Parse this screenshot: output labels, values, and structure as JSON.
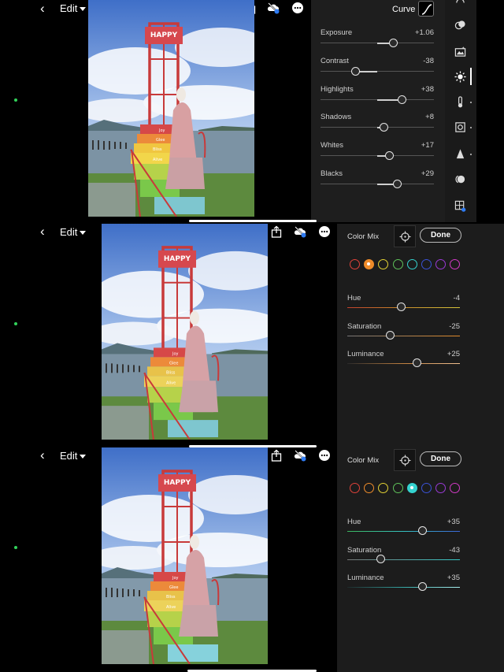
{
  "nav": {
    "edit_label": "Edit"
  },
  "panel1": {
    "title": "Curve",
    "sliders": [
      {
        "label": "Exposure",
        "value": "+1.06",
        "pos": 0.64
      },
      {
        "label": "Contrast",
        "value": "-38",
        "pos": 0.31
      },
      {
        "label": "Highlights",
        "value": "+38",
        "pos": 0.72
      },
      {
        "label": "Shadows",
        "value": "+8",
        "pos": 0.56
      },
      {
        "label": "Whites",
        "value": "+17",
        "pos": 0.61
      },
      {
        "label": "Blacks",
        "value": "+29",
        "pos": 0.68
      }
    ]
  },
  "panel2": {
    "title": "Color Mix",
    "done_label": "Done",
    "selected_swatch": "orange",
    "sliders": [
      {
        "label": "Hue",
        "value": "-4",
        "pos": 0.48
      },
      {
        "label": "Saturation",
        "value": "-25",
        "pos": 0.38
      },
      {
        "label": "Luminance",
        "value": "+25",
        "pos": 0.62
      }
    ]
  },
  "panel3": {
    "title": "Color Mix",
    "done_label": "Done",
    "selected_swatch": "aqua",
    "sliders": [
      {
        "label": "Hue",
        "value": "+35",
        "pos": 0.67
      },
      {
        "label": "Saturation",
        "value": "-43",
        "pos": 0.3
      },
      {
        "label": "Luminance",
        "value": "+35",
        "pos": 0.67
      }
    ]
  },
  "swatches": [
    {
      "name": "red",
      "color": "#e0423a"
    },
    {
      "name": "orange",
      "color": "#ef8c2a"
    },
    {
      "name": "yellow",
      "color": "#e3d234"
    },
    {
      "name": "green",
      "color": "#5fc25a"
    },
    {
      "name": "aqua",
      "color": "#35d3d0"
    },
    {
      "name": "blue",
      "color": "#3a52d6"
    },
    {
      "name": "purple",
      "color": "#9a3ad6"
    },
    {
      "name": "magenta",
      "color": "#d23ac6"
    }
  ],
  "gradients": {
    "orange_hue": "linear-gradient(90deg,#c2402c,#c88d2a,#d6c43a)",
    "orange_sat": "linear-gradient(90deg,#777,#e08a2a)",
    "orange_lum": "linear-gradient(90deg,#2a2a2a,#c08040,#f0c090)",
    "aqua_hue": "linear-gradient(90deg,#3bb85e,#35c0c0,#3a66d8)",
    "aqua_sat": "linear-gradient(90deg,#777,#35c8c6)",
    "aqua_lum": "linear-gradient(90deg,#1e2a2a,#35a8a6,#a8efef)"
  },
  "photo_text": {
    "sign": "HAPPY",
    "steps": [
      "Joy",
      "Glee",
      "Bliss",
      "Alive"
    ]
  }
}
